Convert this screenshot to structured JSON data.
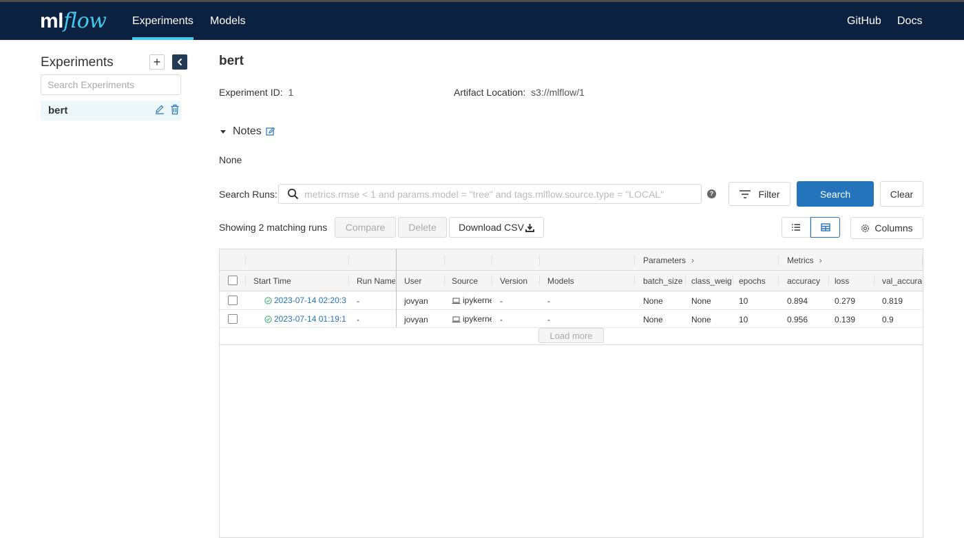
{
  "header": {
    "logo_ml": "ml",
    "logo_flow": "flow",
    "nav": [
      {
        "label": "Experiments"
      },
      {
        "label": "Models"
      }
    ],
    "right_nav": [
      {
        "label": "GitHub"
      },
      {
        "label": "Docs"
      }
    ]
  },
  "sidebar": {
    "title": "Experiments",
    "add_label": "+",
    "search_placeholder": "Search Experiments",
    "experiments": [
      {
        "name": "bert"
      }
    ]
  },
  "experiment": {
    "name": "bert",
    "id_label": "Experiment ID:",
    "id_value": "1",
    "artifact_label": "Artifact Location:",
    "artifact_value": "s3://mlflow/1",
    "notes_label": "Notes",
    "notes_text": "None"
  },
  "search": {
    "label": "Search Runs:",
    "placeholder": "metrics.rmse < 1 and params.model = \"tree\" and tags.mlflow.source.type = \"LOCAL\"",
    "help": "?",
    "filter_label": "Filter",
    "search_label": "Search",
    "clear_label": "Clear"
  },
  "toolbar": {
    "showing": "Showing 2 matching runs",
    "compare": "Compare",
    "delete": "Delete",
    "download": "Download CSV",
    "columns": "Columns"
  },
  "table": {
    "groups": {
      "parameters": "Parameters",
      "metrics": "Metrics"
    },
    "columns": [
      "Start Time",
      "Run Name",
      "User",
      "Source",
      "Version",
      "Models",
      "batch_size",
      "class_weig",
      "epochs",
      "accuracy",
      "loss",
      "val_accura"
    ],
    "rows": [
      {
        "start_time": "2023-07-14 02:20:3",
        "run_name": "-",
        "user": "jovyan",
        "source": "ipykerne",
        "version": "-",
        "models": "-",
        "batch_size": "None",
        "class_weight": "None",
        "epochs": "10",
        "accuracy": "0.894",
        "loss": "0.279",
        "val_accuracy": "0.819"
      },
      {
        "start_time": "2023-07-14 01:19:1",
        "run_name": "-",
        "user": "jovyan",
        "source": "ipykerne",
        "version": "-",
        "models": "-",
        "batch_size": "None",
        "class_weight": "None",
        "epochs": "10",
        "accuracy": "0.956",
        "loss": "0.139",
        "val_accuracy": "0.9"
      }
    ],
    "load_more": "Load more"
  },
  "colors": {
    "header_bg": "#0b213f",
    "accent": "#43c9ed",
    "primary": "#2374bb",
    "success": "#3cb371"
  }
}
